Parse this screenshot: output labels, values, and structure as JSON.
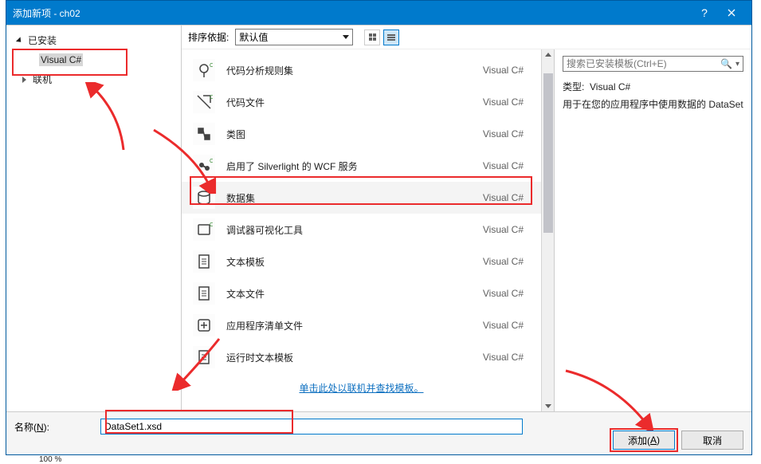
{
  "title": "添加新项 - ch02",
  "sidebar": {
    "root": "已安装",
    "sub": "Visual C#",
    "online": "联机"
  },
  "toolbar": {
    "sort_label": "排序依据:",
    "sort_value": "默认值"
  },
  "items": [
    {
      "label": "代码分析规则集",
      "lang": "Visual C#"
    },
    {
      "label": "代码文件",
      "lang": "Visual C#"
    },
    {
      "label": "类图",
      "lang": "Visual C#"
    },
    {
      "label": "启用了 Silverlight 的 WCF 服务",
      "lang": "Visual C#"
    },
    {
      "label": "数据集",
      "lang": "Visual C#",
      "selected": true
    },
    {
      "label": "调试器可视化工具",
      "lang": "Visual C#"
    },
    {
      "label": "文本模板",
      "lang": "Visual C#"
    },
    {
      "label": "文本文件",
      "lang": "Visual C#"
    },
    {
      "label": "应用程序清单文件",
      "lang": "Visual C#"
    },
    {
      "label": "运行时文本模板",
      "lang": "Visual C#"
    }
  ],
  "golink": "单击此处以联机并查找模板。",
  "search_placeholder": "搜索已安装模板(Ctrl+E)",
  "preview": {
    "type_label": "类型:",
    "type_value": "Visual C#",
    "desc": "用于在您的应用程序中使用数据的 DataSet"
  },
  "footer": {
    "name_label_pre": "名称(",
    "name_label_u": "N",
    "name_label_post": "):",
    "name_value": "DataSet1.xsd",
    "add_pre": "添加(",
    "add_u": "A",
    "add_post": ")",
    "cancel": "取消"
  },
  "status_frag": "100 %"
}
